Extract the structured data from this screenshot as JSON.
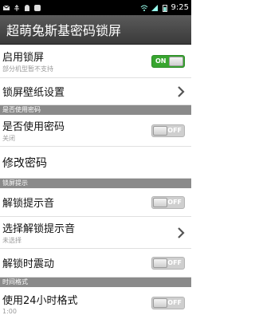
{
  "status_bar": {
    "time": "9:25",
    "icons": [
      "sms-icon",
      "usb-icon",
      "android-icon",
      "app-icon",
      "wifi-icon",
      "signal-icon",
      "battery-icon"
    ]
  },
  "app": {
    "title": "超萌兔斯基密码锁屏"
  },
  "items": {
    "enable_lock": {
      "title": "启用锁屏",
      "subtitle": "部分机型暂不支持",
      "toggle": "ON"
    },
    "wallpaper": {
      "title": "锁屏壁纸设置"
    },
    "section_password": "是否使用密码",
    "use_password": {
      "title": "是否使用密码",
      "subtitle": "关闭",
      "toggle": "OFF"
    },
    "change_password": {
      "title": "修改密码"
    },
    "section_unlock": "锁屏提示",
    "unlock_sound": {
      "title": "解锁提示音",
      "toggle": "OFF"
    },
    "choose_sound": {
      "title": "选择解锁提示音",
      "subtitle": "未选择"
    },
    "unlock_vibrate": {
      "title": "解锁时震动",
      "toggle": "OFF"
    },
    "section_time": "时间格式",
    "use_24h": {
      "title": "使用24小时格式",
      "subtitle": "1:00",
      "toggle": "OFF"
    }
  },
  "colors": {
    "toggle_on": "#37a52f",
    "section_bg": "#8a8a8a",
    "title_bg": "#4a4a4a"
  }
}
